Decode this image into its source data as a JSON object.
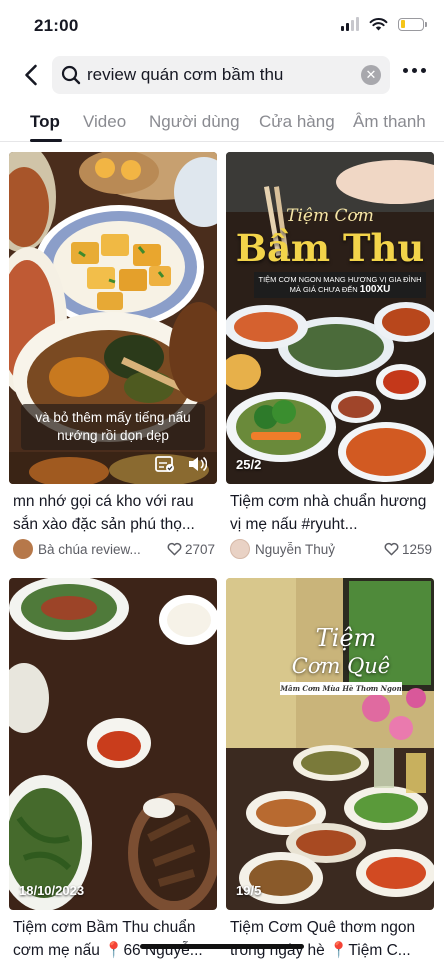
{
  "status_bar": {
    "time": "21:00"
  },
  "search": {
    "query": "review quán cơm bầm thu"
  },
  "tabs": [
    {
      "label": "Top",
      "active": true
    },
    {
      "label": "Video",
      "active": false
    },
    {
      "label": "Người dùng",
      "active": false
    },
    {
      "label": "Cửa hàng",
      "active": false
    },
    {
      "label": "Âm thanh",
      "active": false
    }
  ],
  "results": [
    {
      "caption": "và bỏ thêm mấy tiếng nấu nướng rồi dọn dẹp",
      "title": "mn nhớ gọi cá kho với rau sắn xào đặc sản phú thọ...",
      "author": "Bà chúa review...",
      "likes": "2707"
    },
    {
      "overlay_top": "Tiệm Cơm",
      "overlay_main": "Bầm Thu",
      "overlay_sub1": "TIỆM CƠM NGON MANG HƯƠNG VỊ GIA ĐÌNH",
      "overlay_sub2": "MÀ GIÁ CHƯA ĐẾN",
      "overlay_price": "100XU",
      "date": "25/2",
      "title": "Tiệm cơm nhà chuẩn hương vị mẹ nấu #ryuht...",
      "author": "Nguyễn Thuỷ",
      "likes": "1259"
    },
    {
      "date": "18/10/2023",
      "title": "Tiệm cơm Bầm Thu chuẩn cơm mẹ nấu 📍66 Nguyễ..."
    },
    {
      "overlay_top": "Tiệm",
      "overlay_main": "Cơm Quê",
      "overlay_sub": "Mâm Cơm Mùa Hè Thơm Ngon",
      "date": "19/5",
      "title": "Tiệm Cơm Quê thơm ngon trong ngày hè 📍Tiệm C..."
    }
  ],
  "colors": {
    "accent": "#161823",
    "muted": "#8a8b91",
    "banner_gold": "#f3d44a"
  }
}
